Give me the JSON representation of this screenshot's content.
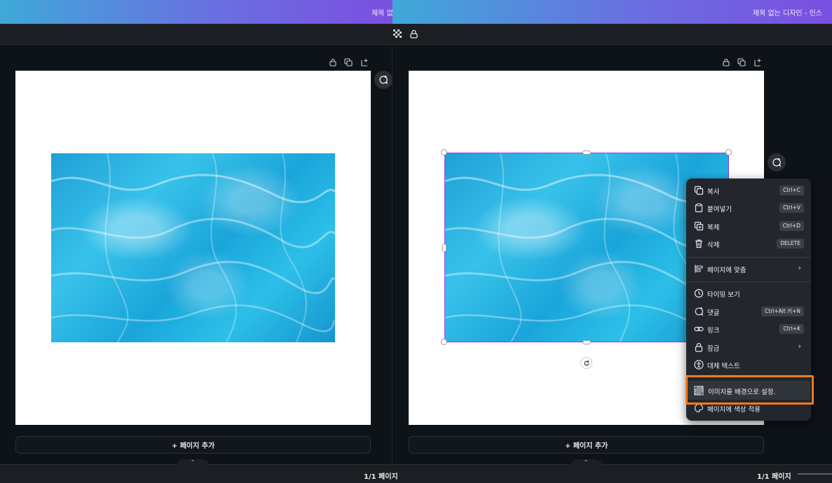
{
  "window": {
    "title_left": "제목 없",
    "title_right": "제목 없는 디자인 - 인스"
  },
  "toolbar": {
    "icons": [
      "transparency-icon",
      "lock-icon"
    ]
  },
  "pages": [
    {
      "add_page_label": "+ 페이지 추가",
      "page_count": "1/1 페이지"
    },
    {
      "add_page_label": "+ 페이지 추가",
      "page_count": "1/1 페이지"
    }
  ],
  "context_menu": {
    "items": [
      {
        "label": "복사",
        "shortcut": "Ctrl+C",
        "icon": "copy-icon"
      },
      {
        "label": "붙여넣기",
        "shortcut": "Ctrl+V",
        "icon": "paste-icon"
      },
      {
        "label": "복제",
        "shortcut": "Ctrl+D",
        "icon": "duplicate-icon"
      },
      {
        "label": "삭제",
        "shortcut": "DELETE",
        "icon": "trash-icon"
      },
      {
        "label": "페이지에 맞춤",
        "icon": "align-icon",
        "submenu": true
      },
      {
        "label": "타이밍 보기",
        "icon": "clock-icon"
      },
      {
        "label": "댓글",
        "shortcut": "Ctrl+Alt 키+N",
        "icon": "comment-icon"
      },
      {
        "label": "링크",
        "shortcut": "Ctrl+K",
        "icon": "link-icon"
      },
      {
        "label": "잠금",
        "icon": "lock-icon",
        "submenu": true
      },
      {
        "label": "대체 텍스트",
        "icon": "accessibility-icon"
      },
      {
        "label": "이미지를 배경으로 설정.",
        "icon": "background-icon",
        "highlighted": true
      },
      {
        "label": "페이지에 색상 적용",
        "icon": "palette-icon"
      }
    ]
  },
  "colors": {
    "selection": "#8b3dff",
    "highlight": "#ff7a1a",
    "menu_bg": "#23272d"
  }
}
